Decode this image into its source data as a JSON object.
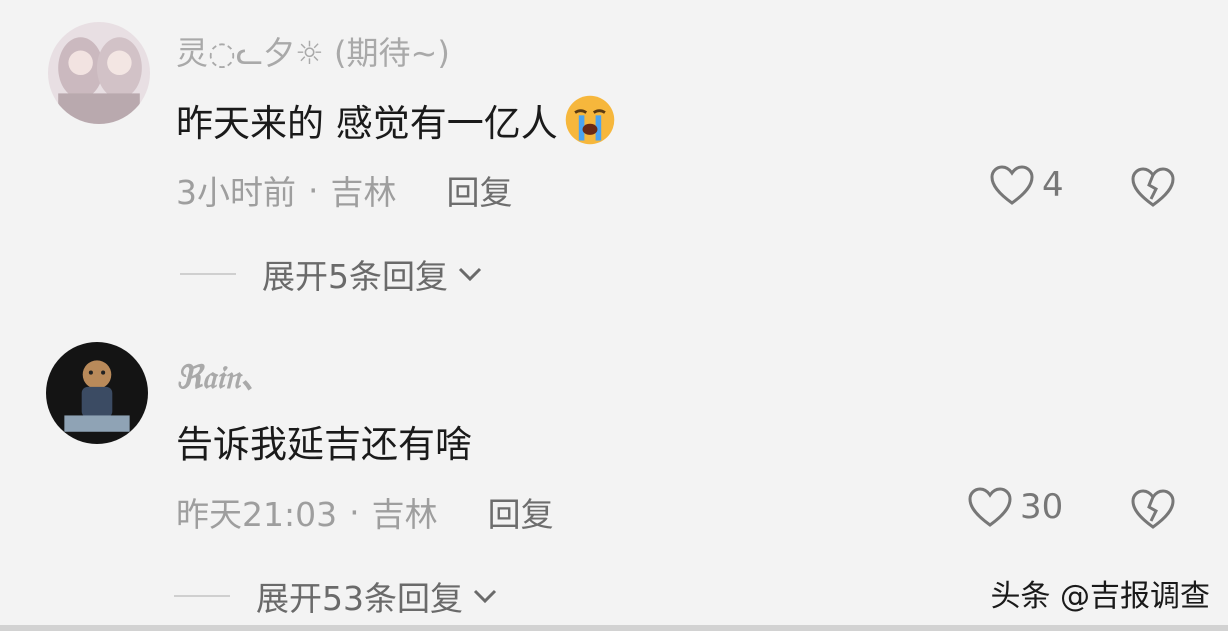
{
  "comments": [
    {
      "username": "灵◌ᓚ夕☼",
      "username_suffix": "(期待~)",
      "text": "昨天来的 感觉有一亿人",
      "emoji": "crying-face",
      "time": "3小时前",
      "location": "吉林",
      "reply_label": "回复",
      "likes": "4",
      "expand_label": "展开5条回复"
    },
    {
      "username": "ℜ𝔞𝔦𝔫、",
      "text": "告诉我延吉还有啥",
      "time": "昨天21:03",
      "location": "吉林",
      "reply_label": "回复",
      "likes": "30",
      "expand_label": "展开53条回复"
    }
  ],
  "meta_separator": "·",
  "watermark": "头条 @吉报调查",
  "colors": {
    "background": "#f3f3f3",
    "text": "#1a1a1a",
    "muted": "#9e9e9e",
    "emoji": "#f6b73c",
    "tear": "#4aa3f0"
  },
  "icons": [
    "heart-outline-icon",
    "broken-heart-icon",
    "chevron-down-icon",
    "crying-face-emoji"
  ]
}
